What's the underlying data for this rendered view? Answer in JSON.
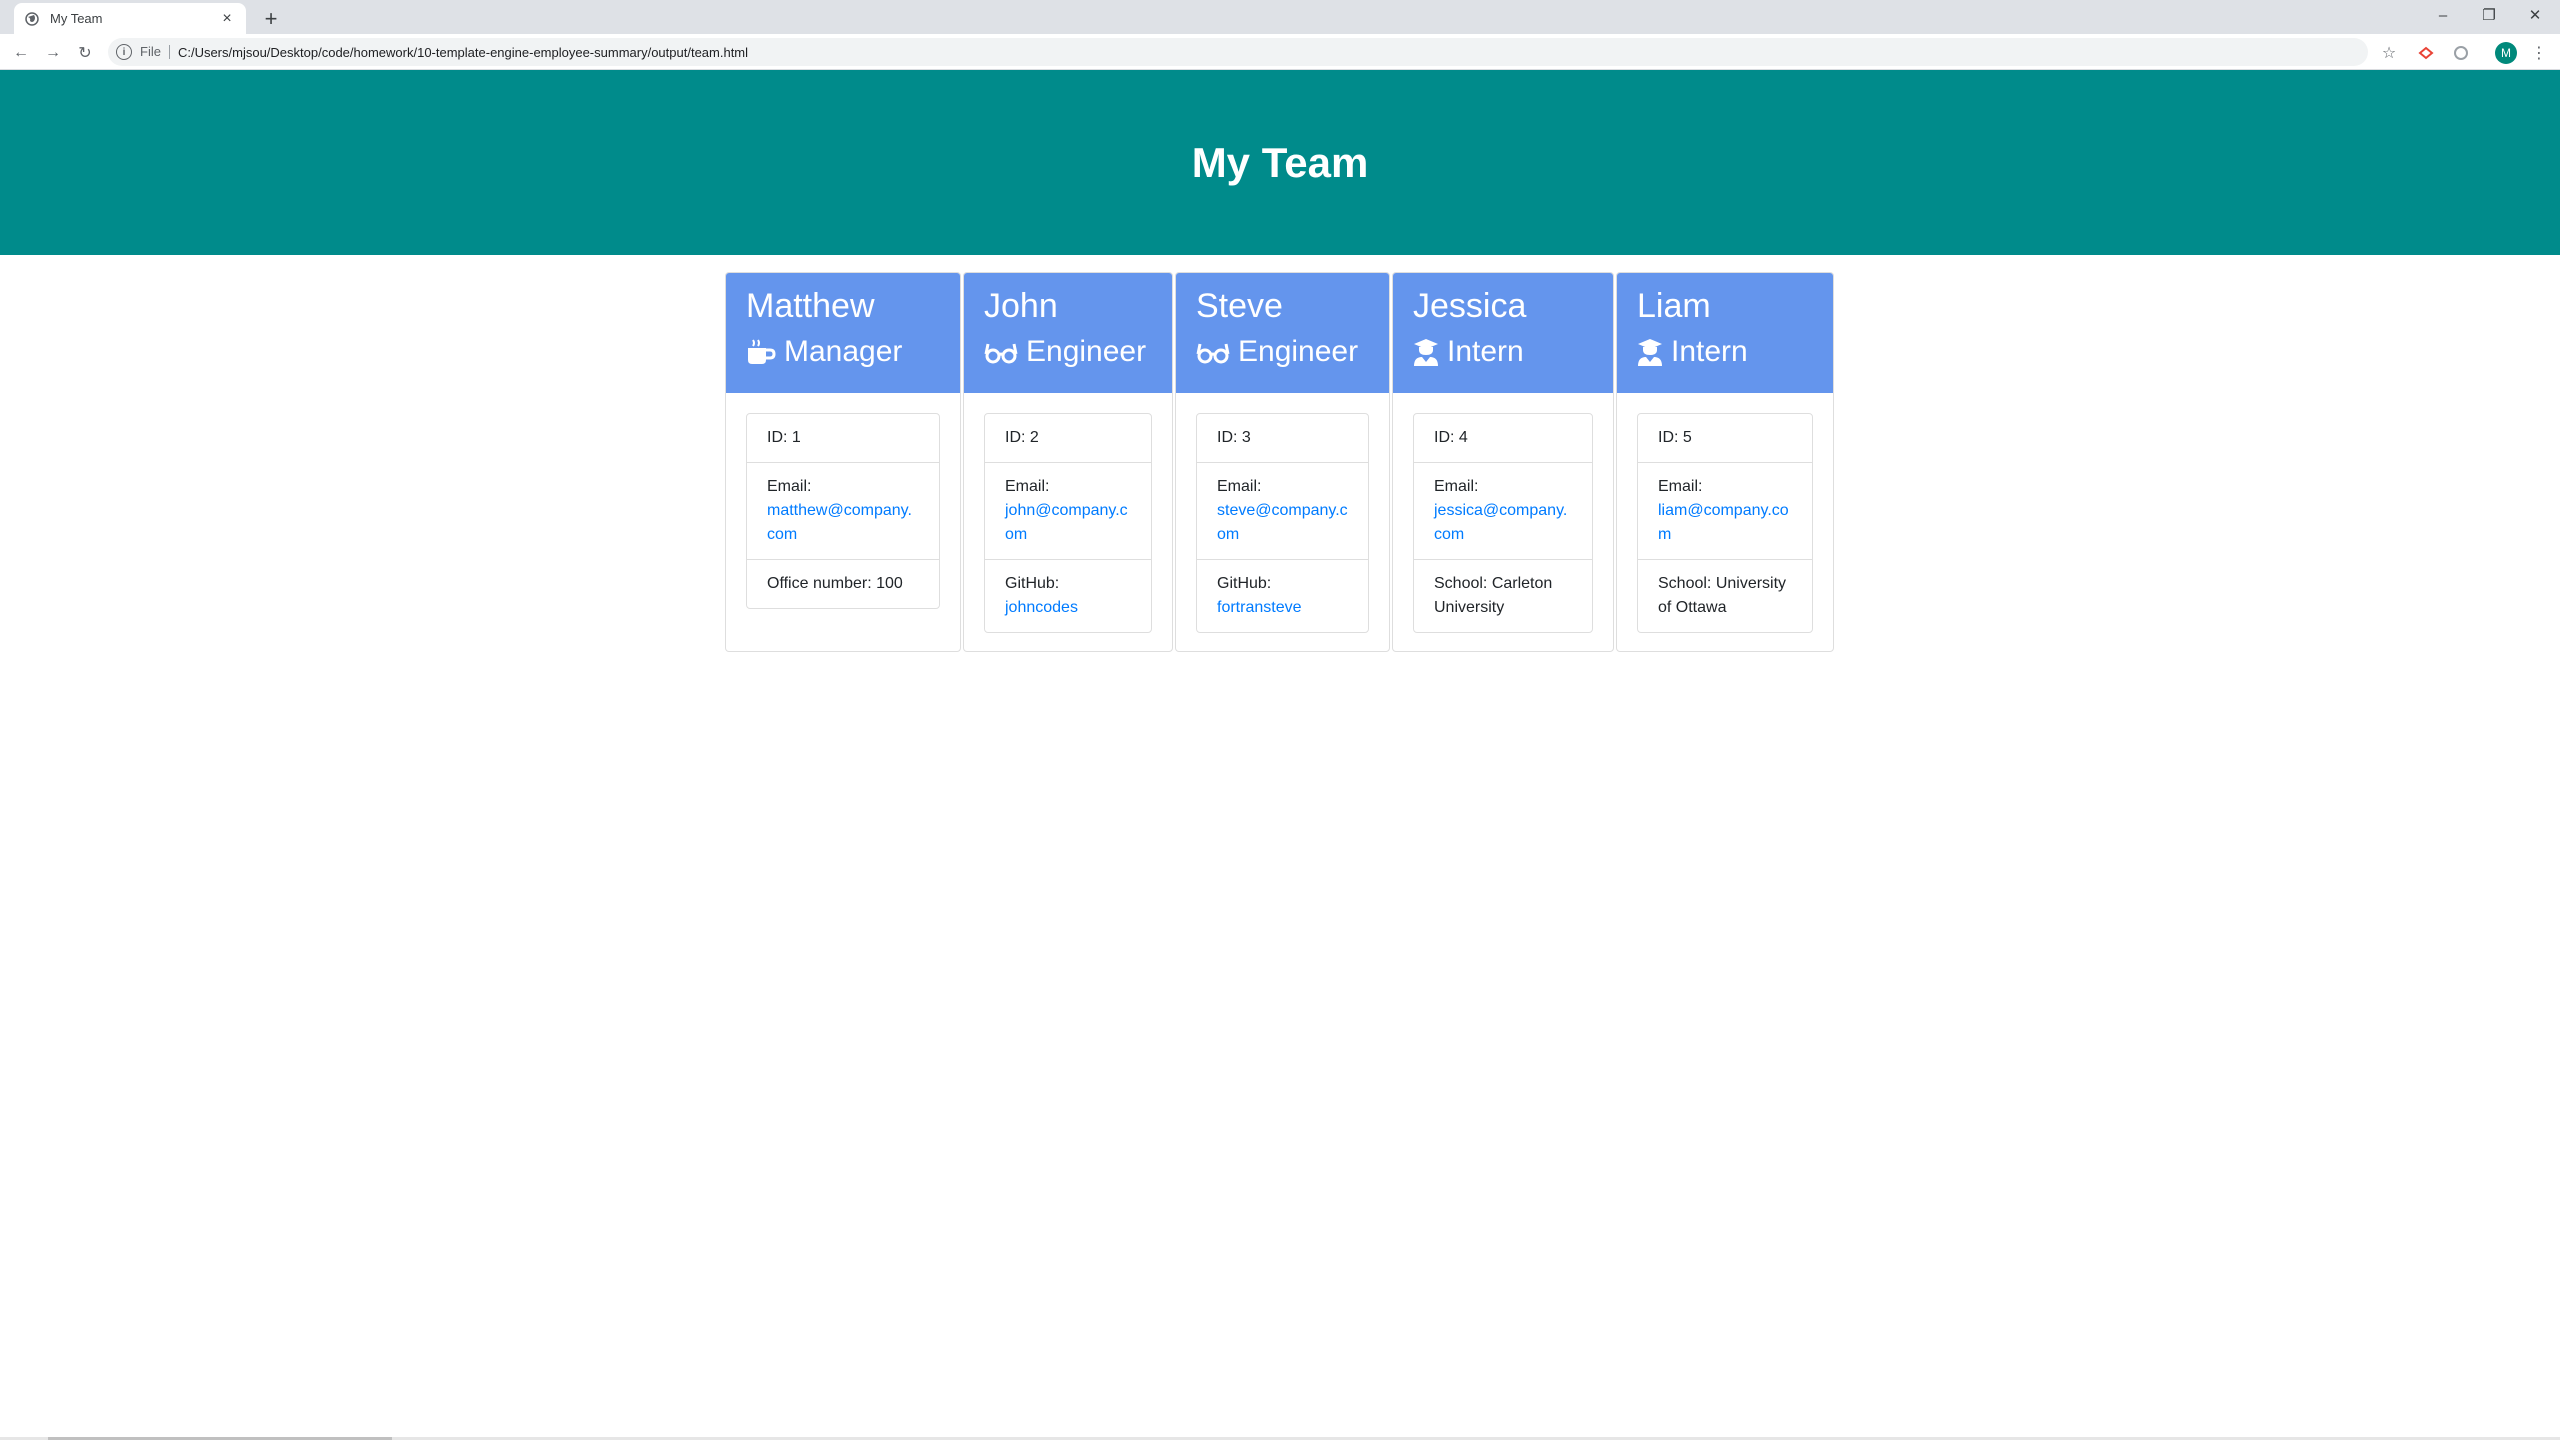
{
  "browser": {
    "tab_title": "My Team",
    "tab_close": "×",
    "new_tab": "+",
    "scheme_label": "File",
    "url": "C:/Users/mjsou/Desktop/code/homework/10-template-engine-employee-summary/output/team.html",
    "avatar_letter": "M"
  },
  "header": {
    "title": "My Team"
  },
  "team": [
    {
      "name": "Matthew",
      "role": "Manager",
      "icon": "mug-icon",
      "id_label": "ID: 1",
      "email_label": "Email:",
      "email": "matthew@company.com",
      "extra_label": "Office number: 100",
      "extra_link": ""
    },
    {
      "name": "John",
      "role": "Engineer",
      "icon": "glasses-icon",
      "id_label": "ID: 2",
      "email_label": "Email:",
      "email": "john@company.com",
      "extra_label": "GitHub:",
      "extra_link": "johncodes"
    },
    {
      "name": "Steve",
      "role": "Engineer",
      "icon": "glasses-icon",
      "id_label": "ID: 3",
      "email_label": "Email:",
      "email": "steve@company.com",
      "extra_label": "GitHub:",
      "extra_link": "fortransteve"
    },
    {
      "name": "Jessica",
      "role": "Intern",
      "icon": "graduate-icon",
      "id_label": "ID: 4",
      "email_label": "Email:",
      "email": "jessica@company.com",
      "extra_label": "School: Carleton University",
      "extra_link": ""
    },
    {
      "name": "Liam",
      "role": "Intern",
      "icon": "graduate-icon",
      "id_label": "ID: 5",
      "email_label": "Email:",
      "email": "liam@company.com",
      "extra_label": "School: University of Ottawa",
      "extra_link": ""
    }
  ],
  "colors": {
    "jumbotron": "#008b8b",
    "card_header": "#6495ed",
    "link": "#007bff"
  }
}
